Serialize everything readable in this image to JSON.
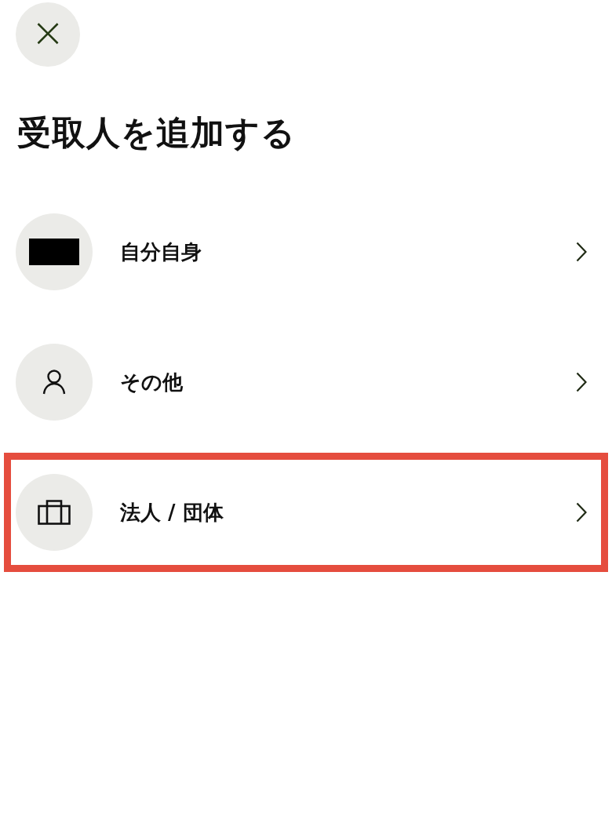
{
  "close_button": {
    "label": "×"
  },
  "title": "受取人を追加する",
  "options": [
    {
      "kind": "self",
      "label": "自分自身",
      "highlighted": false
    },
    {
      "kind": "person",
      "label": "その他",
      "highlighted": false
    },
    {
      "kind": "organization",
      "label": "法人 / 団体",
      "highlighted": true
    }
  ]
}
